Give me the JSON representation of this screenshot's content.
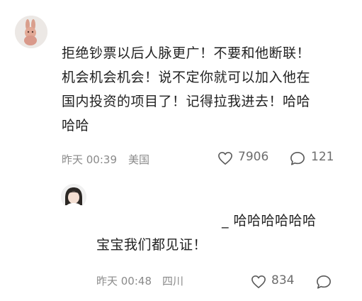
{
  "comment": {
    "lines": [
      "拒绝钞票以后人脉更广！不要和他断联！",
      "机会机会机会！说不定你就可以加入他在",
      "国内投资的项目了！记得拉我进去！哈哈",
      "哈哈"
    ],
    "time": "昨天 00:39",
    "location": "美国",
    "likes": "7906",
    "replies": "121"
  },
  "reply": {
    "lines": [
      "_ 哈哈哈哈哈哈",
      "宝宝我们都见证！"
    ],
    "time": "昨天 00:48",
    "location": "四川",
    "likes": "834"
  },
  "icons": {
    "like": "heart-outline-icon",
    "comment": "speech-bubble-icon"
  }
}
